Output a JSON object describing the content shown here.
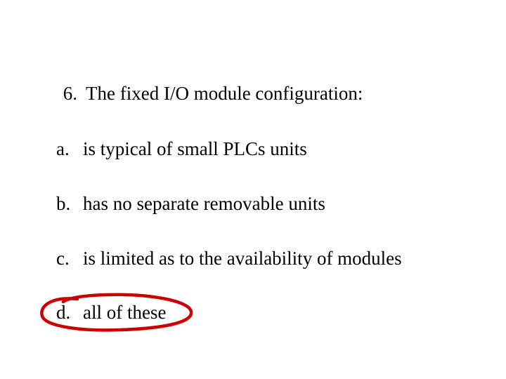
{
  "question": {
    "number": "6.",
    "text": "The fixed I/O module configuration:"
  },
  "options": {
    "a": {
      "letter": "a.",
      "text": "is typical of small PLCs units"
    },
    "b": {
      "letter": "b.",
      "text": "has no separate removable units"
    },
    "c": {
      "letter": "c.",
      "text": "is limited as to the availability of modules"
    },
    "d": {
      "letter": "d.",
      "text": "all of these"
    }
  },
  "annotation": {
    "circled_option": "d",
    "stroke_color": "#cc0000"
  }
}
